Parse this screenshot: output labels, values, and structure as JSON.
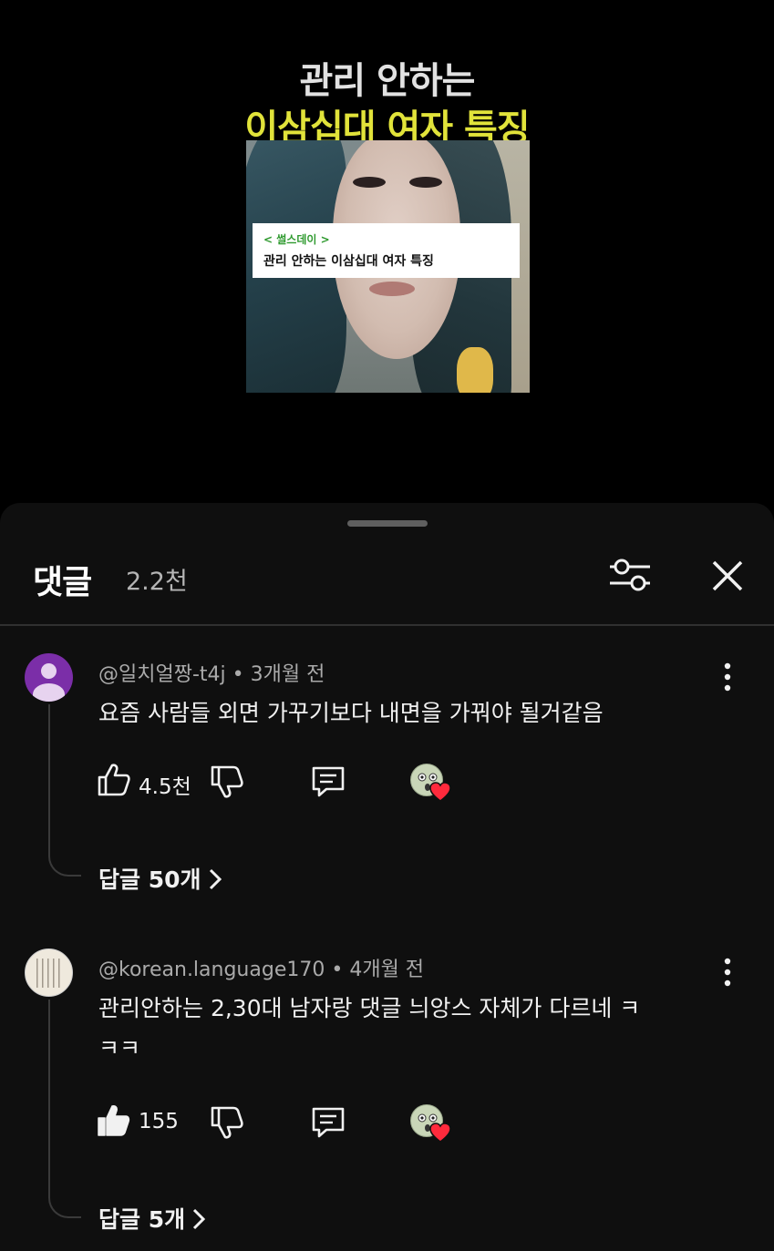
{
  "video": {
    "title_line1": "관리 안하는",
    "title_line2": "이삼십대 여자 특징",
    "caption_tag": "< 썰스데이 >",
    "caption_text": "관리 안하는 이삼십대 여자 특징"
  },
  "comments_sheet": {
    "title": "댓글",
    "count": "2.2천",
    "icons": {
      "filter": "sliders-icon",
      "close": "close-icon"
    }
  },
  "comments": [
    {
      "author": "@일치얼짱-t4j",
      "separator": " • ",
      "time": "3개월 전",
      "text_lines": [
        "요즘 사람들 외면 가꾸기보다 내면을 가꿔야 될거같음"
      ],
      "likes": "4.5천",
      "liked": false,
      "replies_label": "답글 50개",
      "avatar": "default-person-icon",
      "avatar_color": "#7b2ea8"
    },
    {
      "author": "@korean.language170",
      "separator": " • ",
      "time": "4개월 전",
      "text_lines": [
        "관리안하는 2,30대 남자랑 댓글 늬앙스 자체가 다르네 ㅋ",
        "ㅋㅋ"
      ],
      "likes": "155",
      "liked": true,
      "replies_label": "답글 5개",
      "avatar": "calligraphy-paper-icon",
      "avatar_color": "#efe9dd"
    }
  ],
  "colors": {
    "background": "#0f0f0f",
    "title_yellow": "#e1e33a",
    "heart": "#ff2a3c",
    "meta_gray": "#aaaaaa"
  }
}
